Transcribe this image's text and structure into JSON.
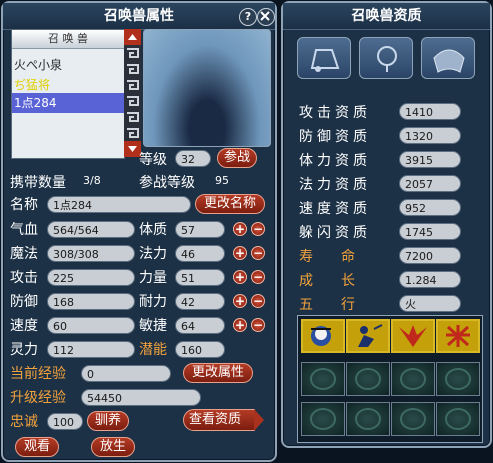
{
  "left": {
    "title": "召唤兽属性",
    "help_glyph": "?",
    "list_header": "召 唤 兽",
    "pets": [
      "火ぺ小泉",
      "ぢ猛将",
      "1点284"
    ],
    "level_label": "等级",
    "level_value": "32",
    "fight_btn": "参战",
    "carry_label": "携带数量",
    "carry_value": "3/8",
    "fight_level_label": "参战等级",
    "fight_level_value": "95",
    "name_label": "名称",
    "name_value": "1点284",
    "rename_btn": "更改名称",
    "stats_left": [
      {
        "label": "气血",
        "value": "564/564"
      },
      {
        "label": "魔法",
        "value": "308/308"
      },
      {
        "label": "攻击",
        "value": "225"
      },
      {
        "label": "防御",
        "value": "168"
      },
      {
        "label": "速度",
        "value": "60"
      },
      {
        "label": "灵力",
        "value": "112"
      }
    ],
    "stats_right": [
      {
        "label": "体质",
        "value": "57"
      },
      {
        "label": "法力",
        "value": "46"
      },
      {
        "label": "力量",
        "value": "51"
      },
      {
        "label": "耐力",
        "value": "42"
      },
      {
        "label": "敏捷",
        "value": "64"
      }
    ],
    "potential_label": "潜能",
    "potential_value": "160",
    "exp_label": "当前经验",
    "exp_value": "0",
    "change_attr_btn": "更改属性",
    "up_exp_label": "升级经验",
    "up_exp_value": "54450",
    "loyalty_label": "忠诚",
    "loyalty_value": "100",
    "tame_btn": "驯养",
    "view_res_btn": "查看资质",
    "watch_btn": "观看",
    "release_btn": "放生",
    "colors": {
      "accent_orange": "#f2a23c",
      "button_red": "#b43b25",
      "selected_row": "#5a63d6"
    }
  },
  "right": {
    "title": "召唤兽资质",
    "aptitudes": [
      {
        "label": "攻击资质",
        "value": "1410"
      },
      {
        "label": "防御资质",
        "value": "1320"
      },
      {
        "label": "体力资质",
        "value": "3915"
      },
      {
        "label": "法力资质",
        "value": "2057"
      },
      {
        "label": "速度资质",
        "value": "952"
      },
      {
        "label": "躲闪资质",
        "value": "1745"
      }
    ],
    "extra": [
      {
        "label": "寿　　命",
        "value": "7200"
      },
      {
        "label": "成　　长",
        "value": "1.284"
      },
      {
        "label": "五　　行",
        "value": "火"
      }
    ],
    "equip_icons": [
      "helmet-icon",
      "necklace-icon",
      "armor-icon"
    ],
    "skill_icons": [
      "mind-skill-icon",
      "kneel-skill-icon",
      "wings-skill-icon",
      "cross-skill-icon"
    ]
  }
}
